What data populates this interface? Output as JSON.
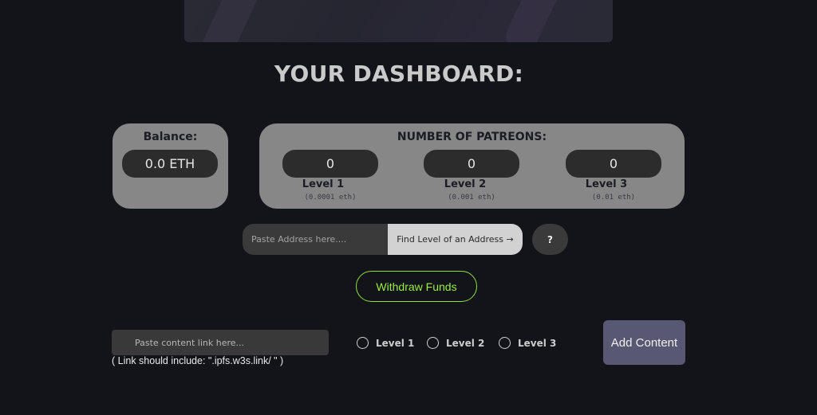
{
  "dashboard": {
    "title": "YOUR DASHBOARD:"
  },
  "balance": {
    "label": "Balance:",
    "value": "0.0 ETH"
  },
  "patreons": {
    "label": "NUMBER OF PATREONS:",
    "levels": [
      {
        "name": "Level 1",
        "count": "0",
        "price": "(0.0001 eth)"
      },
      {
        "name": "Level 2",
        "count": "0",
        "price": "(0.001 eth)"
      },
      {
        "name": "Level 3",
        "count": "0",
        "price": "(0.01 eth)"
      }
    ]
  },
  "lookup": {
    "placeholder": "Paste Address here....",
    "button_label": "Find Level of an Address →",
    "help_label": "?"
  },
  "withdraw": {
    "label": "Withdraw Funds"
  },
  "content": {
    "placeholder": "Paste content link here...",
    "hint": "( Link should include: \".ipfs.w3s.link/ \" )",
    "radio_levels": [
      "Level 1",
      "Level 2",
      "Level 3"
    ],
    "add_label": "Add Content"
  },
  "colors": {
    "background": "#131419",
    "card": "#878787",
    "withdraw_accent": "#9aef3f",
    "add_button": "#585873"
  }
}
